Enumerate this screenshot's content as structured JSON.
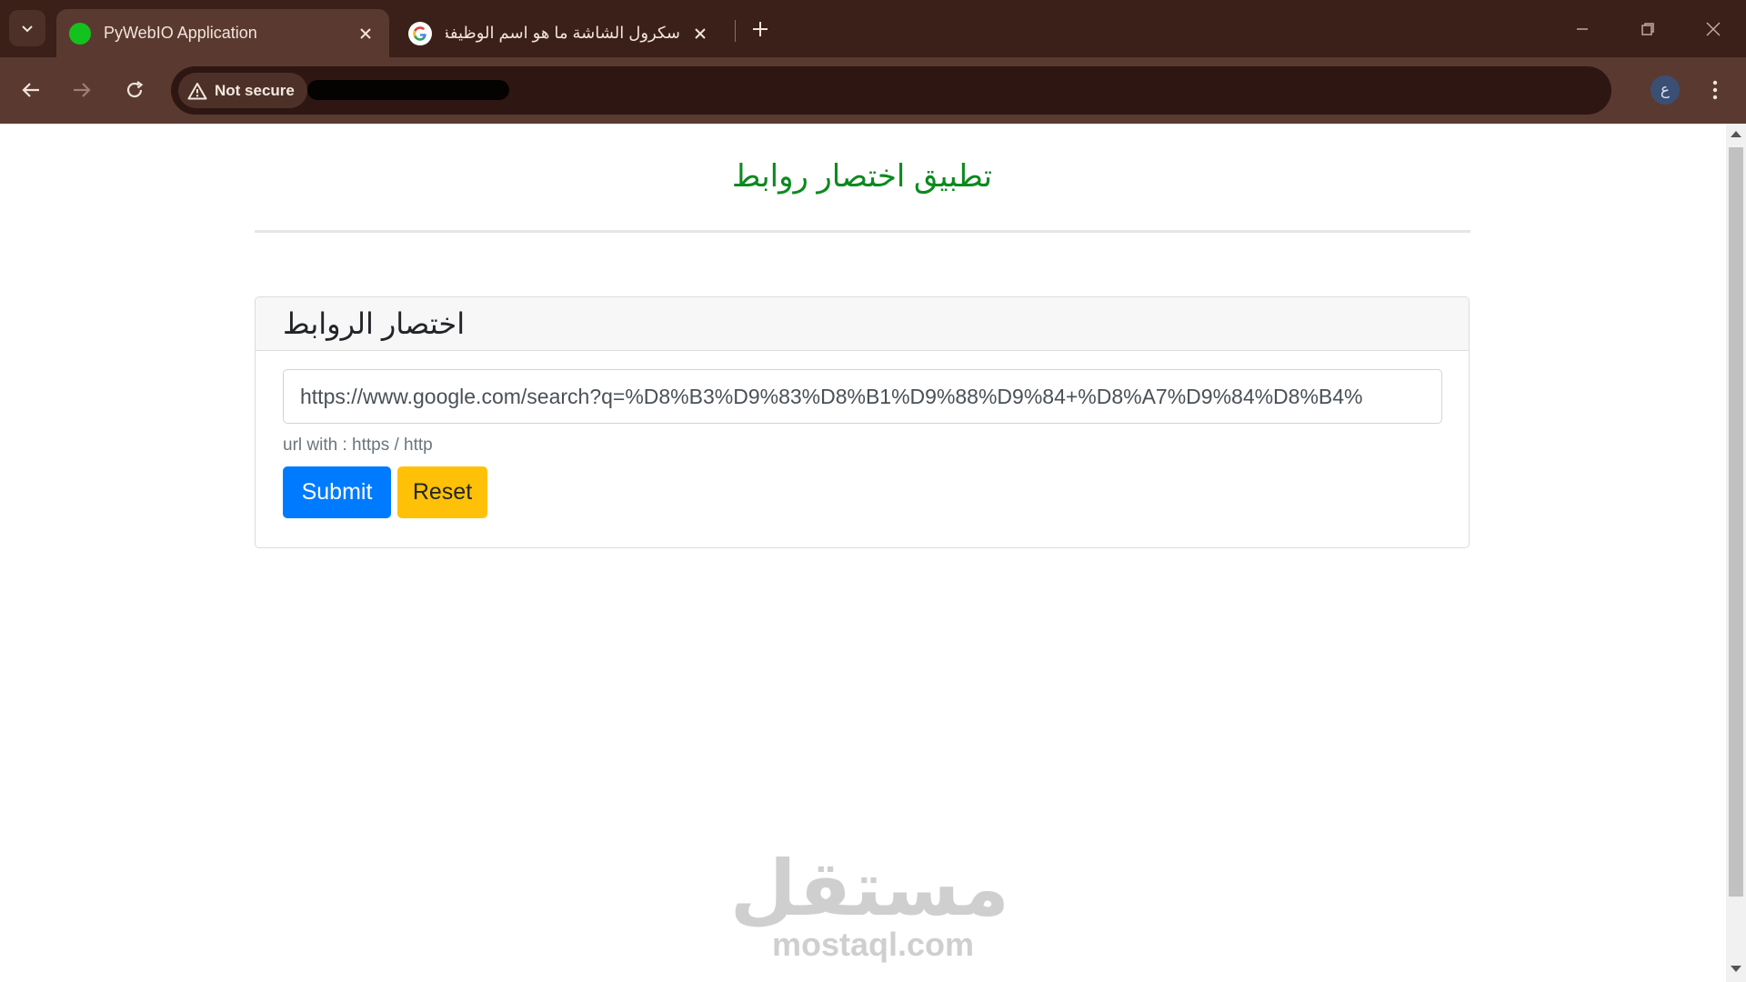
{
  "browser": {
    "tabs": [
      {
        "title": "PyWebIO Application",
        "active": true
      },
      {
        "title": "سكرول الشاشة ما هو اسم الوظيفة -",
        "active": false
      }
    ],
    "security_label": "Not secure",
    "profile_initial": "ع"
  },
  "page": {
    "title": "تطبيق اختصار روابط",
    "card_title": "اختصار الروابط",
    "input_value": "https://www.google.com/search?q=%D8%B3%D9%83%D8%B1%D9%88%D9%84+%D8%A7%D9%84%D8%B4%",
    "help_text": "url with : https / http",
    "submit_label": "Submit",
    "reset_label": "Reset"
  },
  "watermark": {
    "arabic": "مستقل",
    "latin": "mostaql.com"
  },
  "colors": {
    "title_green": "#0b8a1e",
    "submit_blue": "#007bff",
    "reset_yellow": "#ffc107",
    "favicon_green": "#14c21d"
  }
}
